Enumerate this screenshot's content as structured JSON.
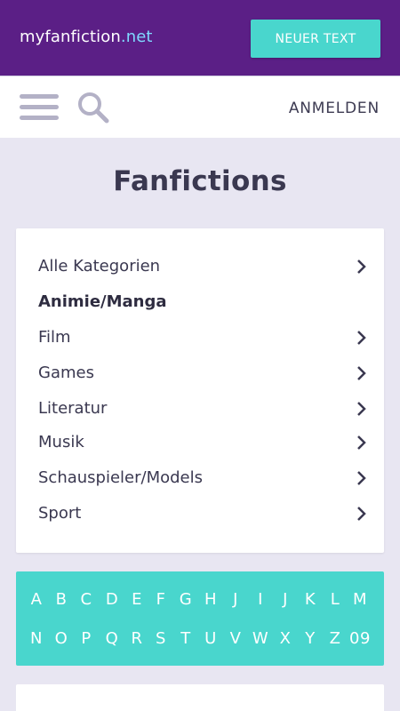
{
  "header": {
    "brand_main": "myfanfiction",
    "brand_tld": ".net",
    "new_text_button": "NEUER TEXT"
  },
  "toolbar": {
    "menu_icon": "hamburger-menu-icon",
    "search_icon": "search-icon",
    "login_label": "ANMELDEN"
  },
  "page": {
    "title": "Fanfictions"
  },
  "categories": [
    {
      "label": "Alle Kategorien",
      "chevron": true,
      "bold": false
    },
    {
      "label": "Animie/Manga",
      "chevron": false,
      "bold": true
    },
    {
      "label": "Film",
      "chevron": true,
      "bold": false
    },
    {
      "label": "Games",
      "chevron": true,
      "bold": false
    },
    {
      "label": "Literatur",
      "chevron": true,
      "bold": false
    },
    {
      "label": "Musik",
      "chevron": true,
      "bold": false
    },
    {
      "label": "Schauspieler/Models",
      "chevron": true,
      "bold": false
    },
    {
      "label": "Sport",
      "chevron": true,
      "bold": false
    }
  ],
  "alphabet": {
    "row1": [
      "A",
      "B",
      "C",
      "D",
      "E",
      "F",
      "G",
      "H",
      "J",
      "I",
      "J",
      "K",
      "L",
      "M"
    ],
    "row2": [
      "N",
      "O",
      "P",
      "Q",
      "R",
      "S",
      "T",
      "U",
      "V",
      "W",
      "X",
      "Y",
      "Z",
      "09"
    ]
  },
  "colors": {
    "topbar": "#5b1f86",
    "accent": "#49d6cd",
    "background": "#e8e6f2",
    "tld": "#7fd9ff"
  }
}
